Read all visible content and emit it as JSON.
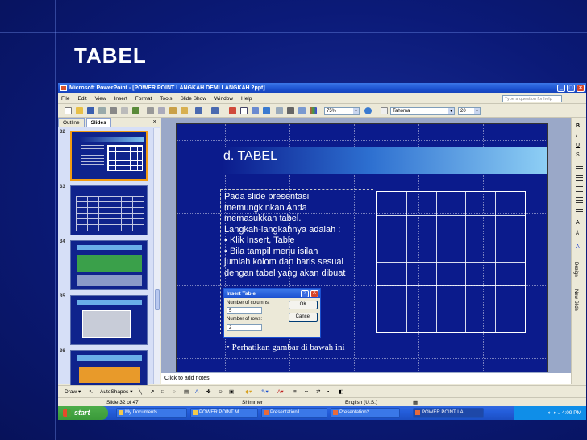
{
  "slide_title": "TABEL",
  "window": {
    "title": "Microsoft PowerPoint - [POWER POINT LANGKAH DEMI LANGKAH 2ppt]",
    "help_placeholder": "Type a question for help"
  },
  "menu": [
    "File",
    "Edit",
    "View",
    "Insert",
    "Format",
    "Tools",
    "Slide Show",
    "Window",
    "Help"
  ],
  "toolbar": {
    "zoom": "75%",
    "font": "Tahoma",
    "font_size": "20"
  },
  "left_pane": {
    "tabs": [
      "Outline",
      "Slides"
    ],
    "close": "x",
    "slides": [
      {
        "number": "32",
        "selected": true
      },
      {
        "number": "33",
        "selected": false
      },
      {
        "number": "34",
        "selected": false
      },
      {
        "number": "35",
        "selected": false
      },
      {
        "number": "36",
        "selected": false
      }
    ]
  },
  "slide": {
    "heading": "d. TABEL",
    "body_lines": [
      "Pada slide presentasi",
      "memungkinkan Anda",
      "memasukkan tabel.",
      "Langkah-langkahnya adalah :",
      "▪ Klik Insert, Table",
      "▪ Bila tampil menu isilah",
      "jumlah kolom dan baris sesuai",
      "dengan tabel yang akan dibuat"
    ],
    "footer": "• Perhatikan gambar di bawah ini",
    "table": {
      "columns": 5,
      "rows": 6
    }
  },
  "dialog": {
    "title": "Insert Table",
    "help": "?",
    "close": "X",
    "columns_label": "Number of columns:",
    "columns_value": "5",
    "rows_label": "Number of rows:",
    "rows_value": "2",
    "ok": "OK",
    "cancel": "Cancel"
  },
  "right_pane": {
    "design": "Design",
    "new_slide": "New Slide"
  },
  "notes_placeholder": "Click to add notes",
  "drawbar": {
    "draw": "Draw ▾",
    "autoshapes": "AutoShapes ▾"
  },
  "status": {
    "slide_of": "Slide 32 of 47",
    "design": "Shimmer",
    "language": "English (U.S.)"
  },
  "taskbar": {
    "start": "start",
    "items": [
      "My Documents",
      "POWER POINT M...",
      "Presentation1",
      "Presentation2",
      "POWER POINT LA..."
    ],
    "clock": "4:09 PM"
  }
}
